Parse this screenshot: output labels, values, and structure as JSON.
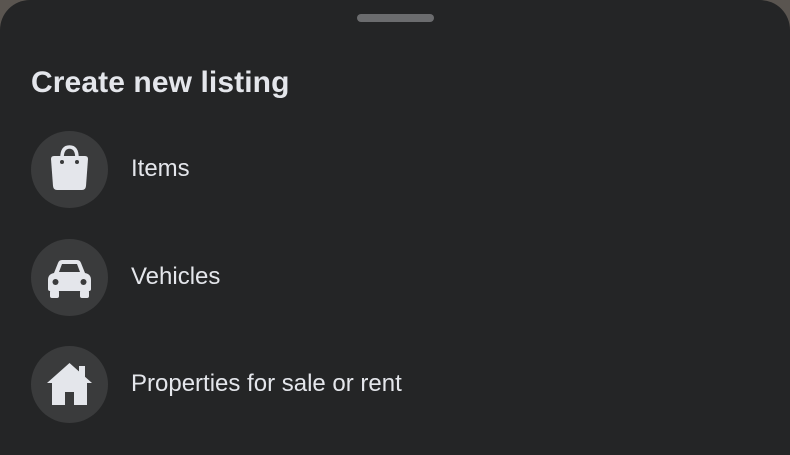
{
  "sheet": {
    "title": "Create new listing",
    "options": [
      {
        "label": "Items",
        "icon": "shopping-bag-icon"
      },
      {
        "label": "Vehicles",
        "icon": "car-icon"
      },
      {
        "label": "Properties for sale or rent",
        "icon": "house-icon"
      }
    ]
  },
  "colors": {
    "sheet_background": "#242526",
    "icon_circle": "#3a3b3c",
    "text": "#e4e6eb",
    "grabber": "#6b6c6e"
  }
}
